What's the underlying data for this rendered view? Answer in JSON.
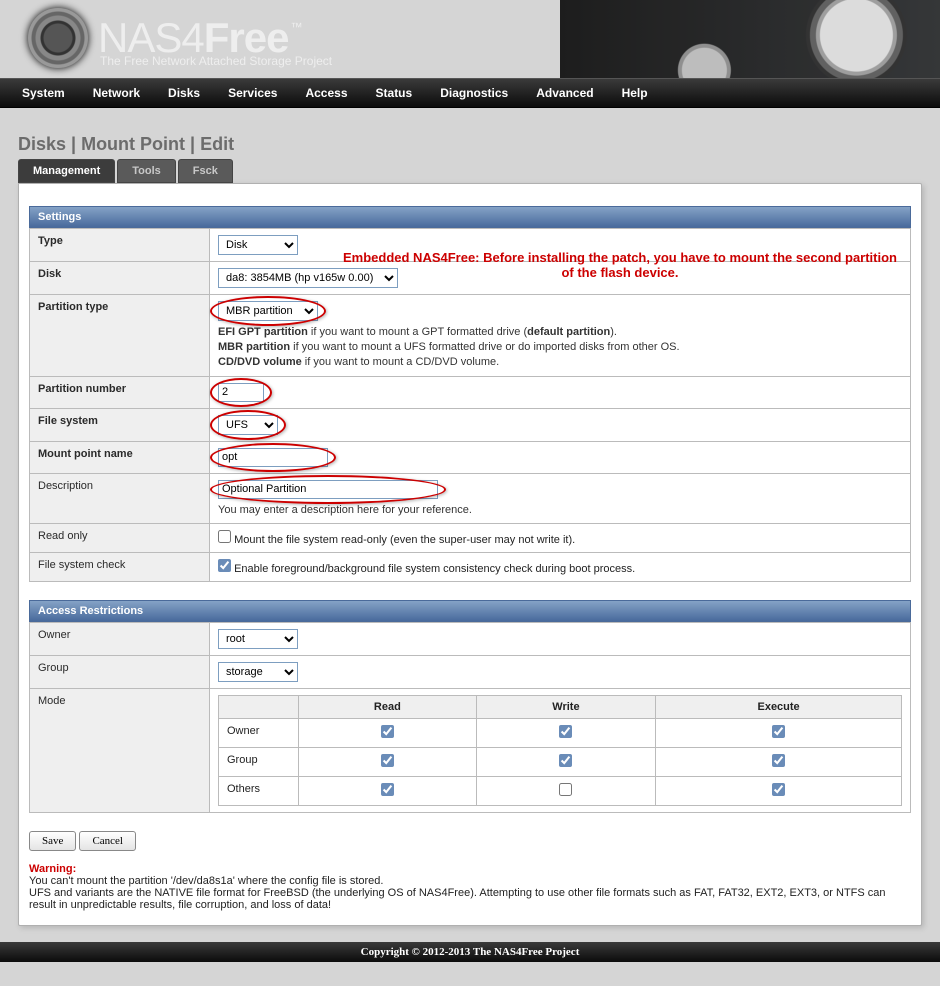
{
  "brand": {
    "nas": "NAS",
    "four": "4",
    "free": "Free",
    "tm": "™",
    "slogan": "The Free Network Attached Storage Project"
  },
  "nav": [
    "System",
    "Network",
    "Disks",
    "Services",
    "Access",
    "Status",
    "Diagnostics",
    "Advanced",
    "Help"
  ],
  "breadcrumb": "Disks | Mount Point | Edit",
  "notice": "Embedded NAS4Free: Before installing the patch, you have to mount the second partition of the flash device.",
  "tabs": [
    "Management",
    "Tools",
    "Fsck"
  ],
  "section_settings": "Settings",
  "section_access": "Access Restrictions",
  "fields": {
    "type": {
      "label": "Type",
      "value": "Disk"
    },
    "disk": {
      "label": "Disk",
      "value": "da8: 3854MB (hp v165w 0.00)"
    },
    "ptype": {
      "label": "Partition type",
      "value": "MBR partition"
    },
    "ptype_help1a": "EFI GPT partition",
    "ptype_help1b": " if you want to mount a GPT formatted drive (",
    "ptype_help1c": "default partition",
    "ptype_help1d": ").",
    "ptype_help2a": "MBR partition",
    "ptype_help2b": " if you want to mount a UFS formatted drive or do imported disks from other OS.",
    "ptype_help3a": "CD/DVD volume",
    "ptype_help3b": " if you want to mount a CD/DVD volume.",
    "pnum": {
      "label": "Partition number",
      "value": "2"
    },
    "fs": {
      "label": "File system",
      "value": "UFS"
    },
    "mpname": {
      "label": "Mount point name",
      "value": "opt"
    },
    "desc": {
      "label": "Description",
      "value": "Optional Partition",
      "help": "You may enter a description here for your reference."
    },
    "readonly": {
      "label": "Read only",
      "caption": "Mount the file system read-only (even the super-user may not write it)."
    },
    "fsck": {
      "label": "File system check",
      "caption": "Enable foreground/background file system consistency check during boot process."
    },
    "owner": {
      "label": "Owner",
      "value": "root"
    },
    "group": {
      "label": "Group",
      "value": "storage"
    },
    "mode": {
      "label": "Mode"
    }
  },
  "perm": {
    "cols": [
      "Read",
      "Write",
      "Execute"
    ],
    "rows": [
      {
        "name": "Owner",
        "v": [
          true,
          true,
          true
        ]
      },
      {
        "name": "Group",
        "v": [
          true,
          true,
          true
        ]
      },
      {
        "name": "Others",
        "v": [
          true,
          false,
          true
        ]
      }
    ]
  },
  "buttons": {
    "save": "Save",
    "cancel": "Cancel"
  },
  "warning": {
    "head": "Warning:",
    "l1": "You can't mount the partition '/dev/da8s1a' where the config file is stored.",
    "l2": "UFS and variants are the NATIVE file format for FreeBSD (the underlying OS of NAS4Free). Attempting to use other file formats such as FAT, FAT32, EXT2, EXT3, or NTFS can result in unpredictable results, file corruption, and loss of data!"
  },
  "footer": "Copyright © 2012-2013 The NAS4Free Project"
}
